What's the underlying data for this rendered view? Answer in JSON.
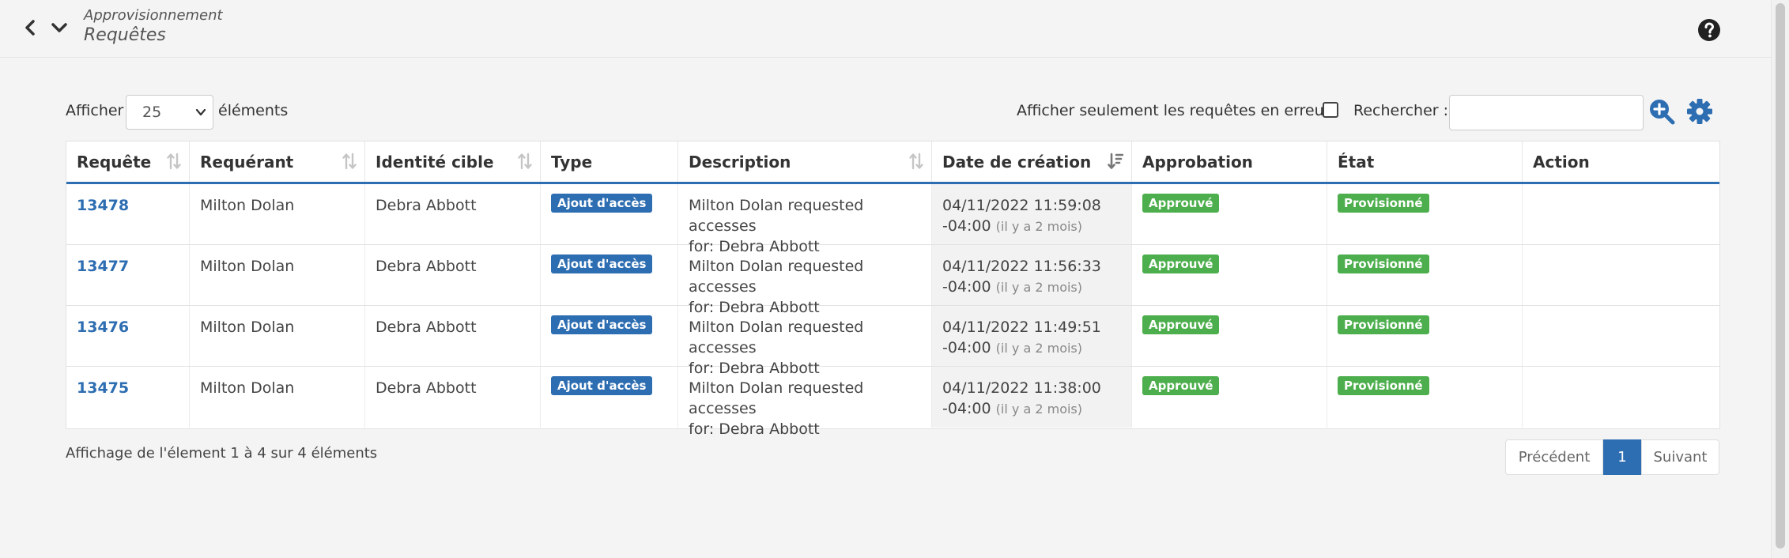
{
  "header": {
    "breadcrumb_parent": "Approvisionnement",
    "page_title": "Requêtes"
  },
  "icons": {
    "back": "chevron-left-icon",
    "menu": "chevron-down-icon",
    "help": "question-circle-icon",
    "search": "zoom-in-icon",
    "settings": "gear-icon"
  },
  "controls": {
    "show_label": "Afficher",
    "page_size": "25",
    "elements_label": "éléments",
    "errors_only_label": "Afficher seulement les requêtes en erreur",
    "search_label": "Rechercher :",
    "search_value": ""
  },
  "table": {
    "columns": [
      "Requête",
      "Requérant",
      "Identité cible",
      "Type",
      "Description",
      "Date de création",
      "Approbation",
      "État",
      "Action"
    ],
    "rows": [
      {
        "id": "13478",
        "requester": "Milton Dolan",
        "target": "Debra Abbott",
        "type": "Ajout d'accès",
        "desc1": "Milton Dolan requested accesses",
        "desc2": "for: Debra Abbott",
        "date1": "04/11/2022 11:59:08",
        "date2": "-04:00",
        "ago": "(il y a 2 mois)",
        "approval": "Approuvé",
        "state": "Provisionné"
      },
      {
        "id": "13477",
        "requester": "Milton Dolan",
        "target": "Debra Abbott",
        "type": "Ajout d'accès",
        "desc1": "Milton Dolan requested accesses",
        "desc2": "for: Debra Abbott",
        "date1": "04/11/2022 11:56:33",
        "date2": "-04:00",
        "ago": "(il y a 2 mois)",
        "approval": "Approuvé",
        "state": "Provisionné"
      },
      {
        "id": "13476",
        "requester": "Milton Dolan",
        "target": "Debra Abbott",
        "type": "Ajout d'accès",
        "desc1": "Milton Dolan requested accesses",
        "desc2": "for: Debra Abbott",
        "date1": "04/11/2022 11:49:51",
        "date2": "-04:00",
        "ago": "(il y a 2 mois)",
        "approval": "Approuvé",
        "state": "Provisionné"
      },
      {
        "id": "13475",
        "requester": "Milton Dolan",
        "target": "Debra Abbott",
        "type": "Ajout d'accès",
        "desc1": "Milton Dolan requested accesses",
        "desc2": "for: Debra Abbott",
        "date1": "04/11/2022 11:38:00",
        "date2": "-04:00",
        "ago": "(il y a 2 mois)",
        "approval": "Approuvé",
        "state": "Provisionné"
      }
    ]
  },
  "footer": {
    "info": "Affichage de l'élement 1 à 4 sur 4 éléments",
    "prev": "Précédent",
    "current_page": "1",
    "next": "Suivant"
  },
  "colors": {
    "accent": "#2d6db1",
    "success": "#4cae4c",
    "background": "#f4f4f4"
  }
}
